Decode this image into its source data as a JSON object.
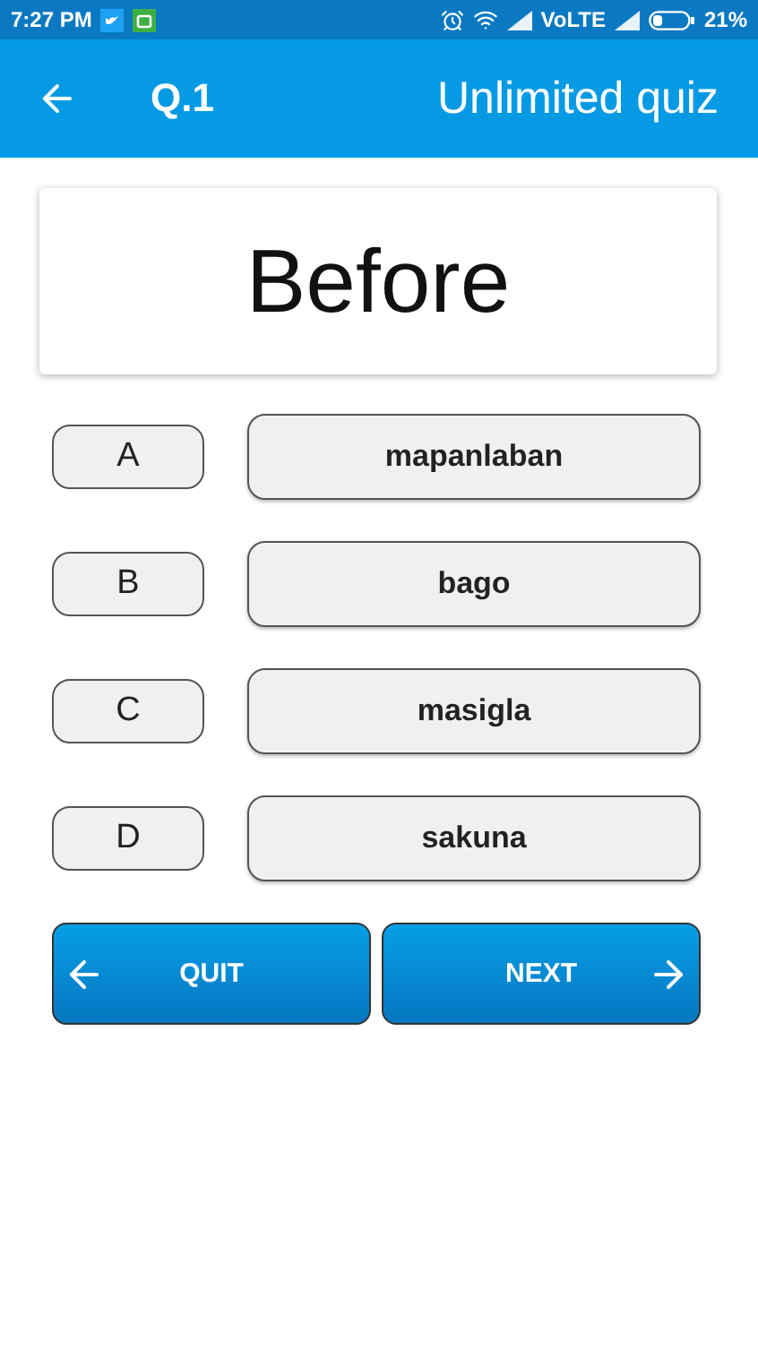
{
  "status_bar": {
    "time": "7:27 PM",
    "network": "VoLTE",
    "battery": "21%"
  },
  "app_bar": {
    "question_number": "Q.1",
    "title": "Unlimited quiz"
  },
  "question": {
    "word": "Before"
  },
  "options": [
    {
      "letter": "A",
      "answer": "mapanlaban"
    },
    {
      "letter": "B",
      "answer": "bago"
    },
    {
      "letter": "C",
      "answer": "masigla"
    },
    {
      "letter": "D",
      "answer": "sakuna"
    }
  ],
  "buttons": {
    "quit": "QUIT",
    "next": "NEXT"
  }
}
